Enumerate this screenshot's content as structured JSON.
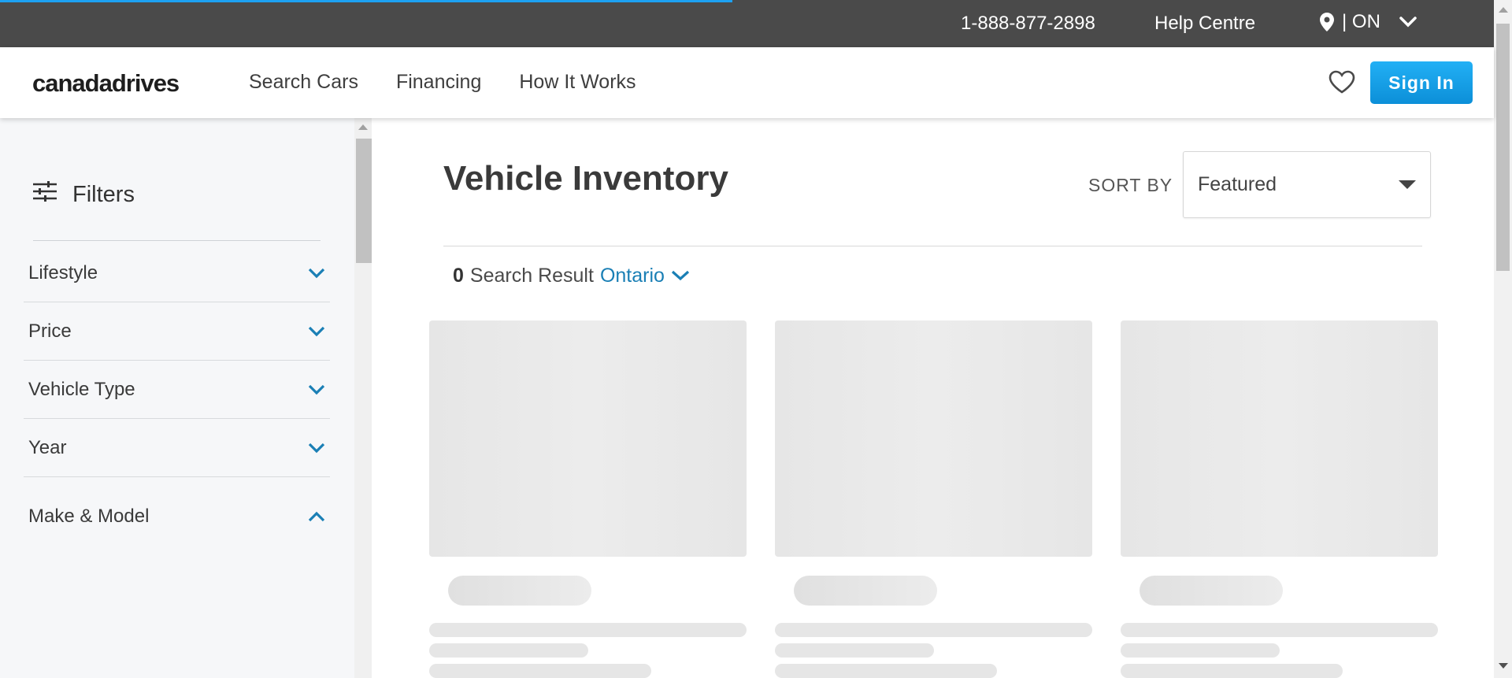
{
  "topbar": {
    "phone": "1-888-877-2898",
    "help": "Help Centre",
    "region": "| ON",
    "progress_fraction": 0.49
  },
  "header": {
    "logo": "canadadrives",
    "nav": [
      "Search Cars",
      "Financing",
      "How It Works"
    ],
    "sign_in": "Sign In"
  },
  "sidebar": {
    "title": "Filters",
    "filters": [
      {
        "label": "Lifestyle",
        "expanded": false
      },
      {
        "label": "Price",
        "expanded": false
      },
      {
        "label": "Vehicle Type",
        "expanded": false
      },
      {
        "label": "Year",
        "expanded": false
      },
      {
        "label": "Make & Model",
        "expanded": true
      }
    ]
  },
  "main": {
    "title": "Vehicle Inventory",
    "sort_label": "SORT BY",
    "sort_value": "Featured",
    "results_count": "0",
    "results_text": "Search Result",
    "results_location": "Ontario"
  },
  "colors": {
    "topbar_bg": "#4a4a4a",
    "accent": "#1da1f2",
    "link": "#1a7fb5",
    "chevron": "#1a7fb5"
  }
}
